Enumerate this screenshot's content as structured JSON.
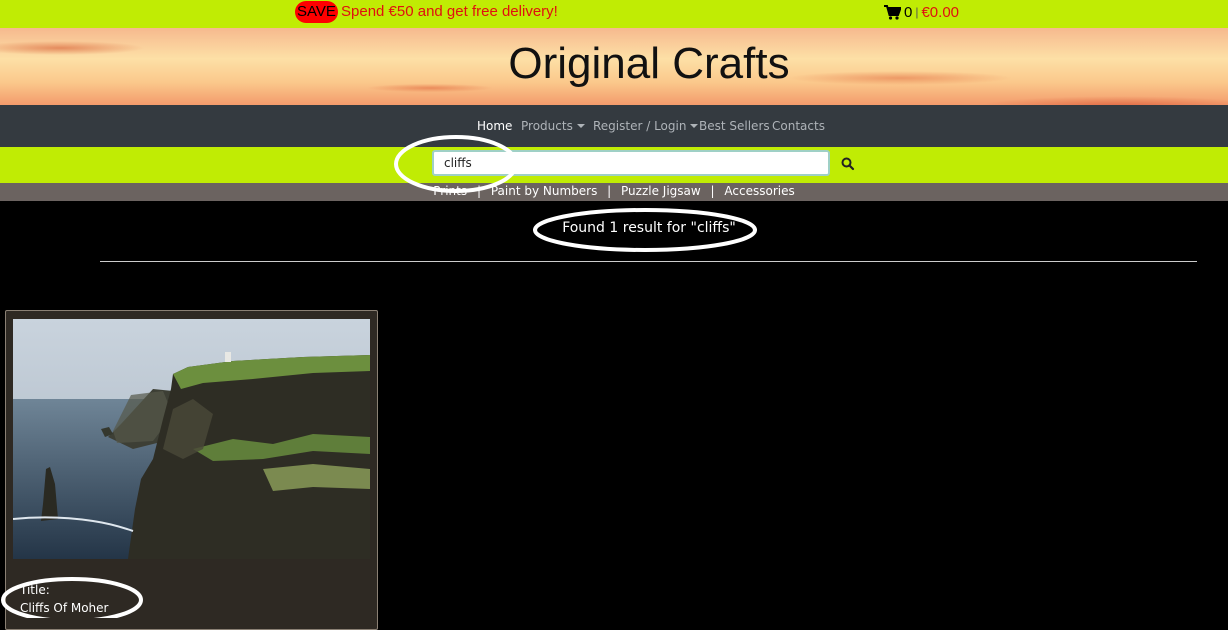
{
  "promo_bar": {
    "badge": "SAVE",
    "message": "Spend €50 and get free delivery!",
    "cart_count": "0",
    "cart_separator": "|",
    "cart_total": "€0.00"
  },
  "header": {
    "site_title": "Original Crafts"
  },
  "nav": {
    "items": [
      {
        "label": "Home"
      },
      {
        "label": "Products"
      },
      {
        "label": "Register / Login"
      },
      {
        "label": "Best Sellers"
      },
      {
        "label": "Contacts"
      }
    ]
  },
  "search": {
    "value": "cliffs",
    "icon": "search-icon"
  },
  "categories": {
    "items": [
      {
        "label": "Prints"
      },
      {
        "label": "Paint by Numbers"
      },
      {
        "label": "Puzzle Jigsaw"
      },
      {
        "label": "Accessories"
      }
    ],
    "separator": "|"
  },
  "results": {
    "summary": "Found 1 result for \"cliffs\""
  },
  "product": {
    "label": "Title:",
    "title": "Cliffs Of Moher"
  },
  "colors": {
    "accent_green": "#c0ec04",
    "save_red": "#ff0000",
    "navbar": "#343a40",
    "category_bar": "#6b6360"
  }
}
